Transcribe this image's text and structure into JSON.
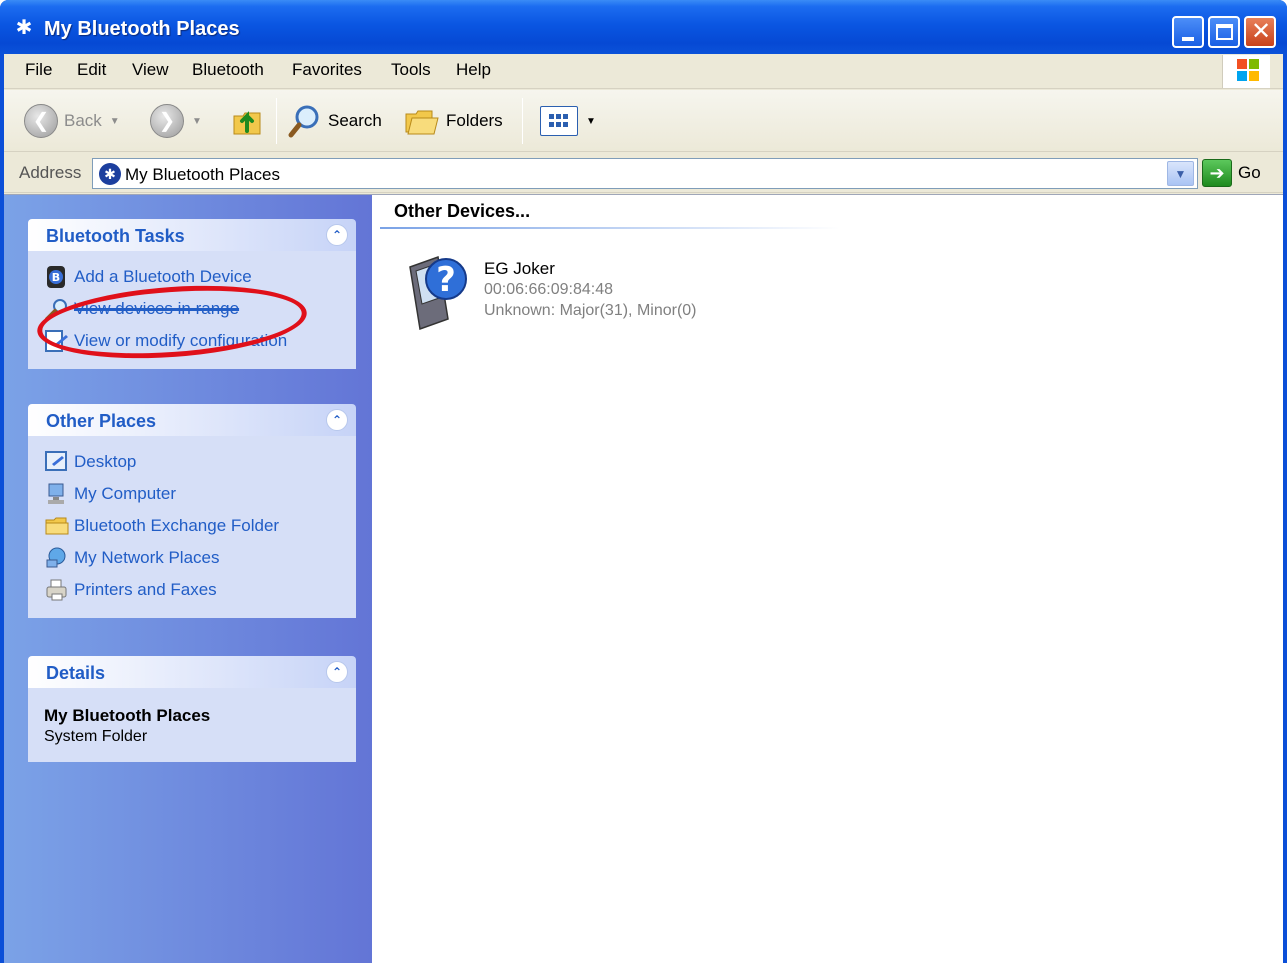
{
  "window": {
    "title": "My Bluetooth Places",
    "title_icon": "bluetooth-icon"
  },
  "menu": {
    "items": [
      {
        "label": "File"
      },
      {
        "label": "Edit"
      },
      {
        "label": "View"
      },
      {
        "label": "Bluetooth"
      },
      {
        "label": "Favorites"
      },
      {
        "label": "Tools"
      },
      {
        "label": "Help"
      }
    ]
  },
  "toolbar": {
    "back_label": "Back",
    "search_label": "Search",
    "folders_label": "Folders"
  },
  "address": {
    "label": "Address",
    "value": "My Bluetooth Places",
    "go_label": "Go"
  },
  "tasks": {
    "bluetooth_tasks": {
      "title": "Bluetooth Tasks",
      "items": [
        {
          "label": "Add a Bluetooth Device",
          "icon": "bluetooth-device-icon"
        },
        {
          "label": "View devices in range",
          "icon": "search-devices-icon"
        },
        {
          "label": "View or modify configuration",
          "icon": "configuration-icon"
        }
      ]
    },
    "other_places": {
      "title": "Other Places",
      "items": [
        {
          "label": "Desktop",
          "icon": "desktop-icon"
        },
        {
          "label": "My Computer",
          "icon": "my-computer-icon"
        },
        {
          "label": "Bluetooth Exchange Folder",
          "icon": "folder-icon"
        },
        {
          "label": "My Network Places",
          "icon": "network-places-icon"
        },
        {
          "label": "Printers and Faxes",
          "icon": "printer-icon"
        }
      ]
    },
    "details": {
      "title": "Details",
      "name": "My Bluetooth Places",
      "type": "System Folder"
    }
  },
  "content": {
    "heading": "Other Devices...",
    "devices": [
      {
        "name": "EG Joker",
        "address": "00:06:66:09:84:48",
        "class": "Unknown: Major(31), Minor(0)",
        "icon": "unknown-device-icon"
      }
    ]
  },
  "colors": {
    "titlebar": "#0a56e2",
    "taskpane": "#6f8de0",
    "link": "#215dc6",
    "highlight": "#e0101a"
  }
}
